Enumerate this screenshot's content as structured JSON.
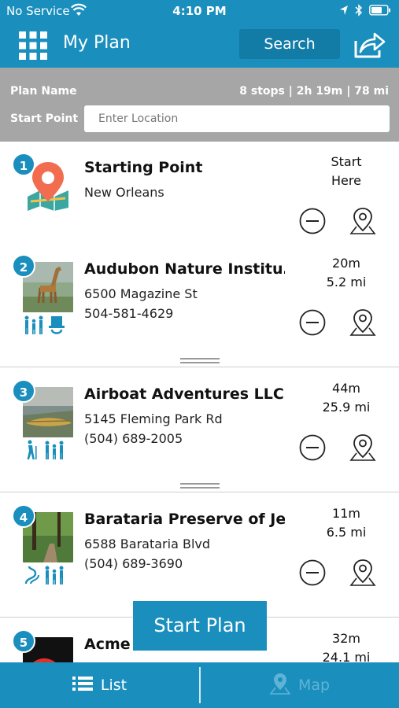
{
  "status_bar": {
    "carrier": "No Service",
    "time": "4:10 PM"
  },
  "header": {
    "title": "My Plan",
    "search_label": "Search",
    "menu_icon": "grid-menu-icon",
    "share_icon": "share-icon"
  },
  "plan": {
    "name_label": "Plan Name",
    "summary": "8 stops | 2h 19m | 78 mi",
    "start_label": "Start Point",
    "location_placeholder": "Enter Location"
  },
  "stops": [
    {
      "number": "1",
      "name": "Starting Point",
      "line1": "New Orleans",
      "line2": "",
      "meta1": "Start",
      "meta2": "Here"
    },
    {
      "number": "2",
      "name": "Audubon Nature Institu…",
      "line1": "6500 Magazine St",
      "line2": "504-581-4629",
      "meta1": "20m",
      "meta2": "5.2 mi"
    },
    {
      "number": "3",
      "name": "Airboat Adventures LLC",
      "line1": "5145 Fleming Park Rd",
      "line2": "(504) 689-2005",
      "meta1": "44m",
      "meta2": "25.9 mi"
    },
    {
      "number": "4",
      "name": "Barataria Preserve of Je…",
      "line1": "6588 Barataria Blvd",
      "line2": "(504) 689-3690",
      "meta1": "11m",
      "meta2": "6.5 mi"
    },
    {
      "number": "5",
      "name": "Acme O",
      "line1": "",
      "line2": "",
      "meta1": "32m",
      "meta2": "24.1 mi"
    }
  ],
  "start_plan_label": "Start Plan",
  "tabs": {
    "list_label": "List",
    "map_label": "Map"
  },
  "colors": {
    "primary": "#1a8fbd",
    "panel": "#a6a6a6",
    "map_pin": "#f26d4f"
  }
}
